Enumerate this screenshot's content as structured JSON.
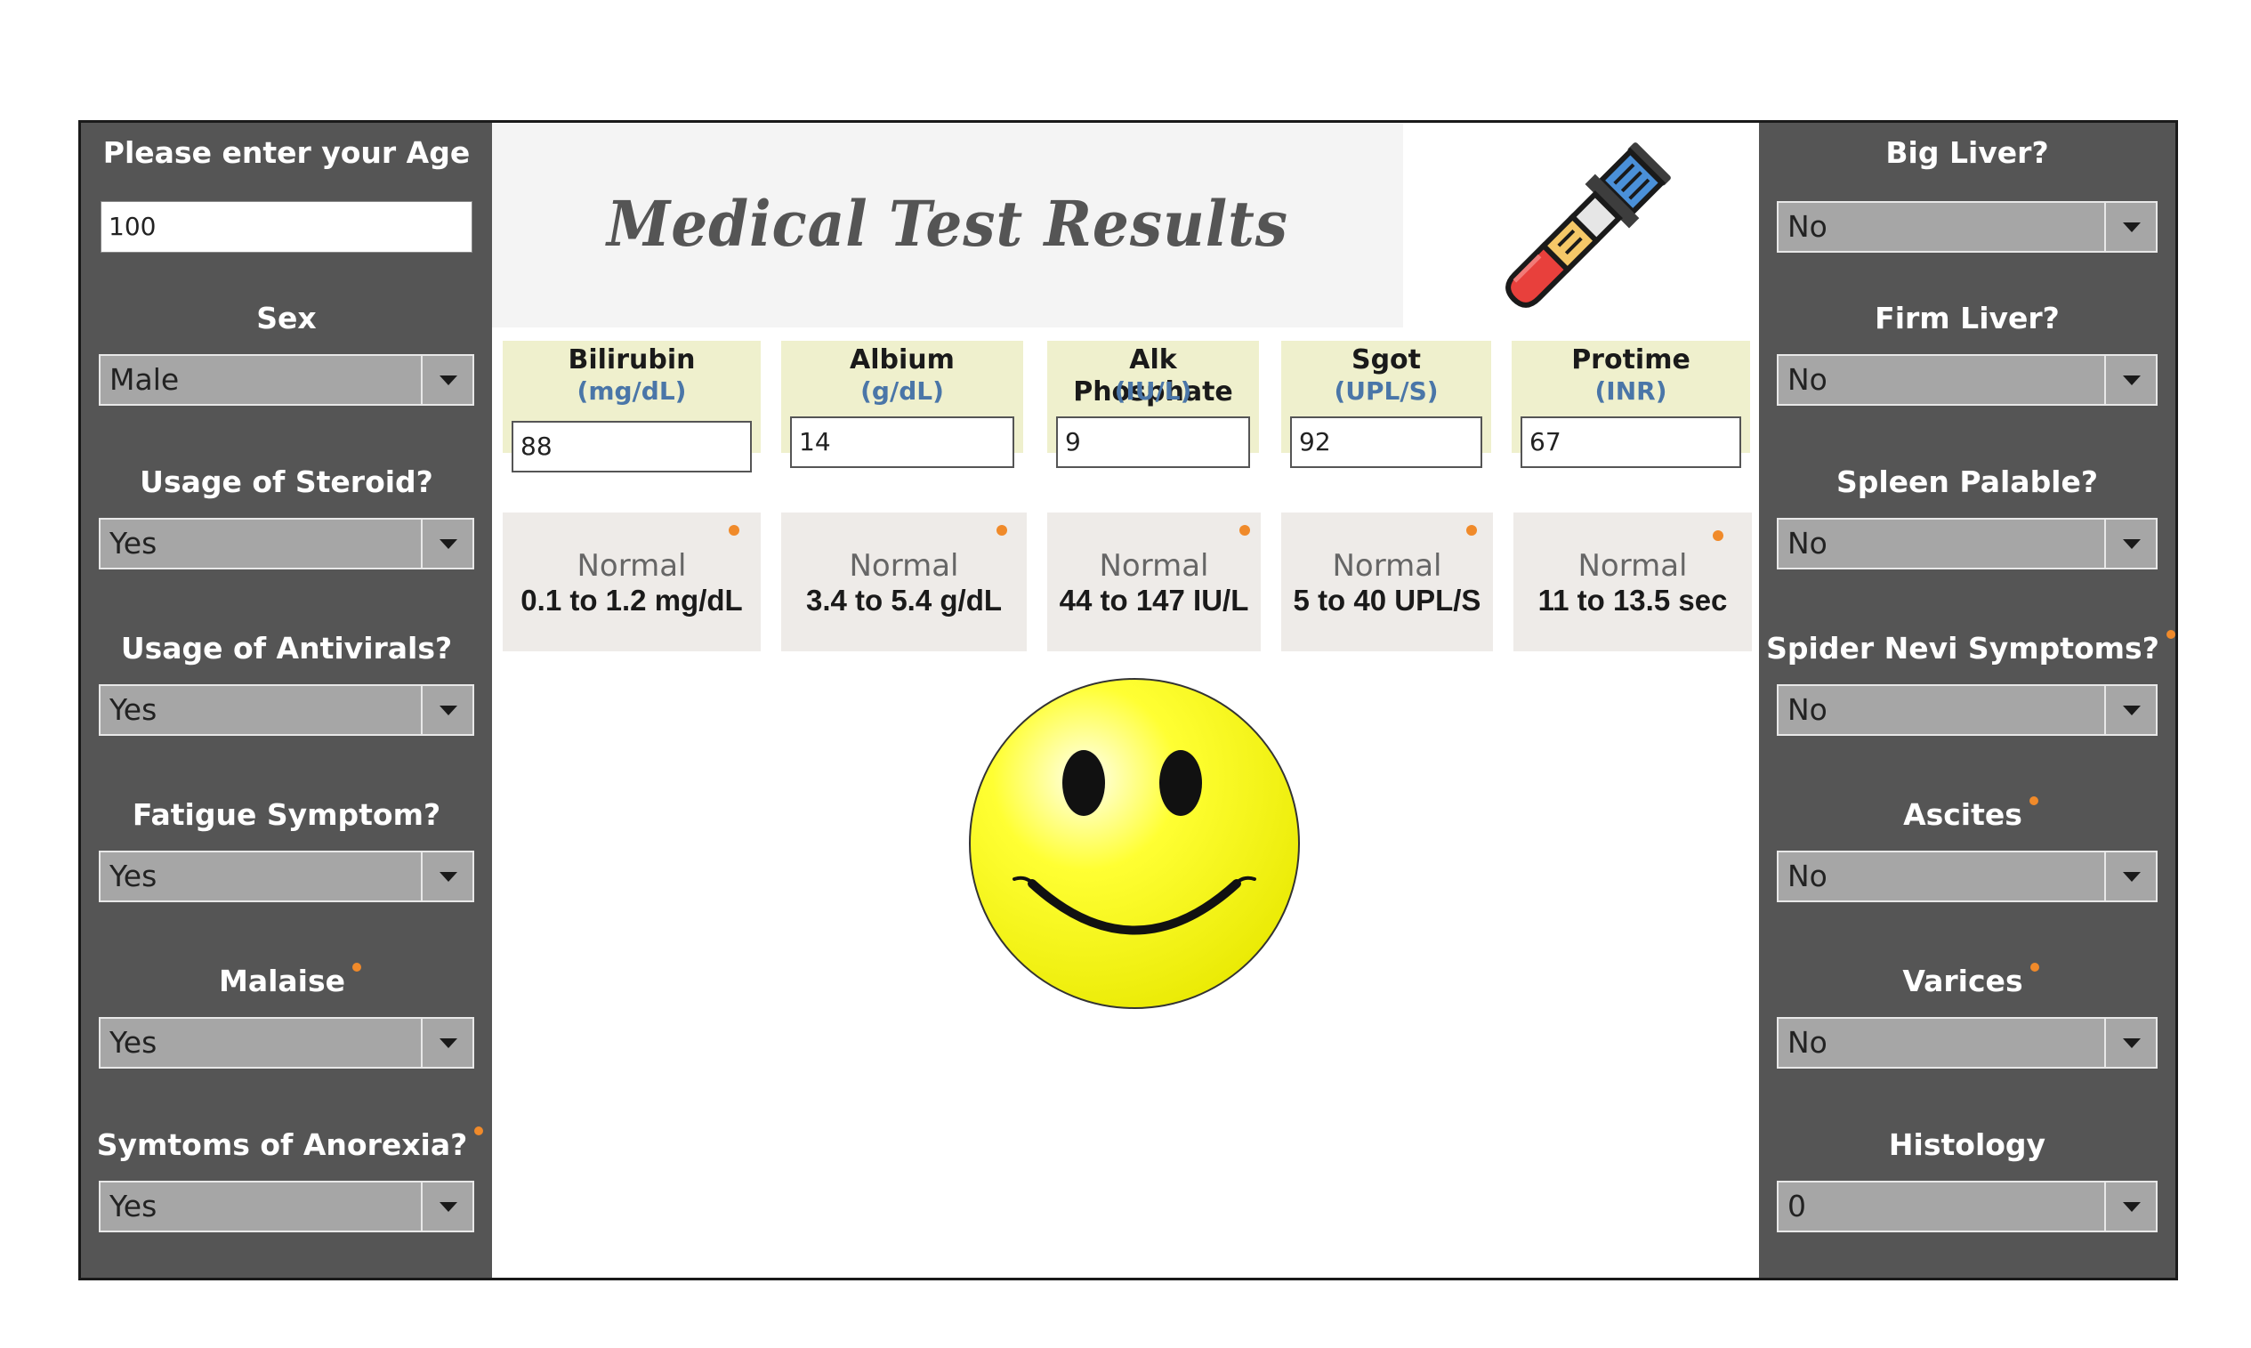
{
  "left_sidebar": {
    "age": {
      "label": "Please enter your Age",
      "value": "100"
    },
    "fields": [
      {
        "label": "Sex",
        "value": "Male",
        "marked": false
      },
      {
        "label": "Usage of Steroid?",
        "value": "Yes",
        "marked": false
      },
      {
        "label": "Usage of Antivirals?",
        "value": "Yes",
        "marked": false
      },
      {
        "label": "Fatigue Symptom?",
        "value": "Yes",
        "marked": false
      },
      {
        "label": "Malaise",
        "value": "Yes",
        "marked": true
      },
      {
        "label": "Symtoms of Anorexia?",
        "value": "Yes",
        "marked": true
      }
    ]
  },
  "right_sidebar": {
    "fields": [
      {
        "label": "Big Liver?",
        "value": "No",
        "marked": false
      },
      {
        "label": "Firm Liver?",
        "value": "No",
        "marked": false
      },
      {
        "label": "Spleen Palable?",
        "value": "No",
        "marked": false
      },
      {
        "label": "Spider Nevi Symptoms?",
        "value": "No",
        "marked": true
      },
      {
        "label": "Ascites",
        "value": "No",
        "marked": true
      },
      {
        "label": "Varices",
        "value": "No",
        "marked": true
      },
      {
        "label": "Histology",
        "value": "0",
        "marked": false
      }
    ]
  },
  "main": {
    "title": "Medical Test Results",
    "tests": [
      {
        "name": "Bilirubin",
        "unit": "(mg/dL)",
        "value": "88",
        "range_label": "Normal",
        "range": "0.1 to 1.2 mg/dL"
      },
      {
        "name": "Albium",
        "unit": "(g/dL)",
        "value": "14",
        "range_label": "Normal",
        "range": "3.4 to 5.4 g/dL"
      },
      {
        "name": "Alk Phosphate",
        "unit": "(IU/L)",
        "value": "9",
        "range_label": "Normal",
        "range": "44 to 147 IU/L"
      },
      {
        "name": "Sgot",
        "unit": "(UPL/S)",
        "value": "92",
        "range_label": "Normal",
        "range": "5 to 40 UPL/S"
      },
      {
        "name": "Protime",
        "unit": "(INR)",
        "value": "67",
        "range_label": "Normal",
        "range": "11 to 13.5 sec"
      }
    ]
  },
  "icons": {
    "tube": "test-tube-icon",
    "result": "smiley-face-icon"
  },
  "colors": {
    "sidebar_bg": "#555555",
    "test_card_bg": "#eff0cd",
    "range_card_bg": "#eeebe8",
    "unit_text": "#4a76a8",
    "marker_dot": "#f08a2a",
    "smiley_face": "#ffff00"
  }
}
